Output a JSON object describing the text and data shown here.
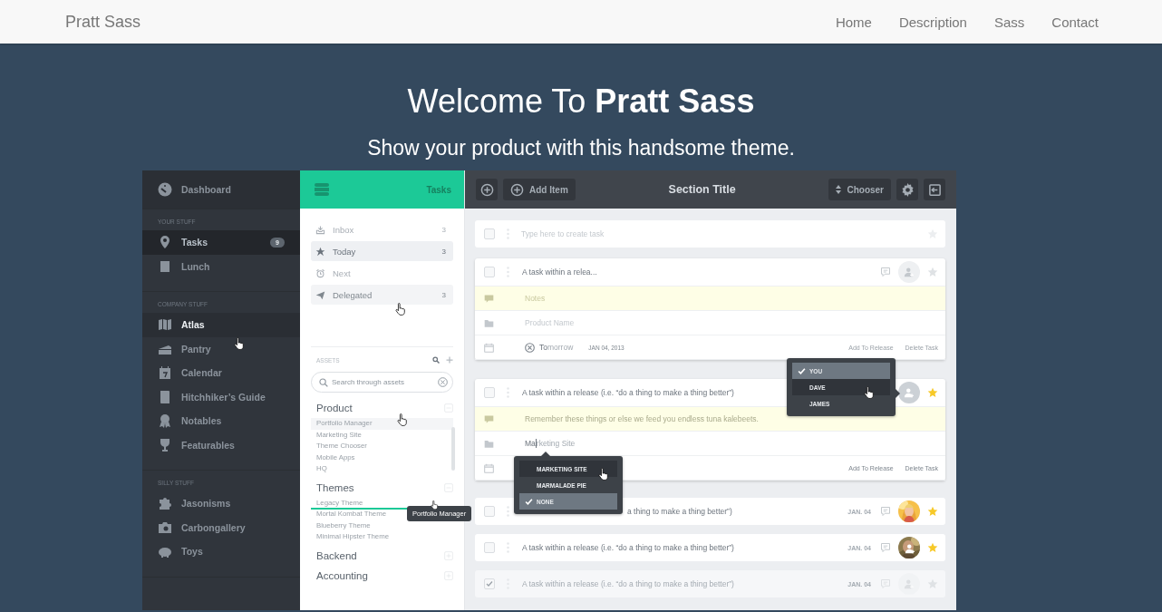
{
  "navbar": {
    "brand": "Pratt Sass",
    "links": [
      {
        "label": "Home"
      },
      {
        "label": "Description"
      },
      {
        "label": "Sass"
      },
      {
        "label": "Contact"
      }
    ]
  },
  "hero": {
    "title": "Welcome To **Pratt Sass**",
    "subtitle": "Show your product with this handsome theme."
  },
  "sidebar": {
    "header": {
      "label": "Dashboard"
    },
    "sections": [
      {
        "title": "YOUR STUFF",
        "items": [
          {
            "label": "Tasks",
            "badge": "9",
            "selected": true,
            "hovered": false
          },
          {
            "label": "Lunch",
            "selected": false,
            "hovered": false
          }
        ]
      },
      {
        "title": "COMPANY STUFF",
        "items": [
          {
            "label": "Atlas",
            "selected": false,
            "hovered": true
          },
          {
            "label": "Pantry",
            "selected": false,
            "hovered": false
          },
          {
            "label": "Calendar",
            "selected": false,
            "hovered": false
          },
          {
            "label": "Hitchhiker’s Guide",
            "selected": false,
            "hovered": false
          },
          {
            "label": "Notables",
            "selected": false,
            "hovered": false
          },
          {
            "label": "Featurables",
            "selected": false,
            "hovered": false
          }
        ]
      },
      {
        "title": "SILLY STUFF",
        "items": [
          {
            "label": "Jasonisms",
            "selected": false,
            "hovered": false
          },
          {
            "label": "Carbongallery",
            "selected": false,
            "hovered": false
          },
          {
            "label": "Toys",
            "selected": false,
            "hovered": false
          }
        ]
      }
    ]
  },
  "tasks_panel": {
    "title": "Tasks",
    "filters": [
      {
        "label": "Inbox",
        "count": "3",
        "selected": false,
        "hovered": false
      },
      {
        "label": "Today",
        "count": "3",
        "selected": true,
        "hovered": false
      },
      {
        "label": "Next",
        "selected": false,
        "hovered": false
      },
      {
        "label": "Delegated",
        "count": "3",
        "selected": false,
        "hovered": true
      }
    ],
    "assets": {
      "title": "ASSETS",
      "search": {
        "placeholder": "Search through assets"
      },
      "groups": [
        {
          "label": "Product",
          "expanded": true,
          "items": [
            {
              "label": "Portfolio Manager",
              "hovered": true,
              "drop_below": false
            },
            {
              "label": "Marketing Site",
              "hovered": false,
              "drop_below": false
            },
            {
              "label": "Theme Chooser",
              "hovered": false,
              "drop_below": false
            },
            {
              "label": "Mobile Apps",
              "hovered": false,
              "drop_below": false
            },
            {
              "label": "HQ",
              "hovered": false,
              "drop_below": false
            }
          ]
        },
        {
          "label": "Themes",
          "expanded": true,
          "items": [
            {
              "label": "Legacy Theme",
              "hovered": false,
              "drop_below": true
            },
            {
              "label": "Mortal Kombat Theme",
              "hovered": false,
              "drop_below": false
            },
            {
              "label": "Blueberry Theme",
              "hovered": false,
              "drop_below": false
            },
            {
              "label": "Minimal Hipster Theme",
              "hovered": false,
              "drop_below": false
            }
          ]
        },
        {
          "label": "Backend",
          "expanded": false
        },
        {
          "label": "Accounting",
          "expanded": false
        }
      ]
    }
  },
  "tooltip": "Portfolio Manager",
  "toolbar": {
    "add_item": "Add Item",
    "title": "Section Title",
    "chooser": "Chooser"
  },
  "tasks": [
    {
      "kind": "new",
      "placeholder": "Type here to create task",
      "checked": false,
      "starred": false
    },
    {
      "kind": "expanded",
      "title": "A task within a relea...",
      "checked": false,
      "starred": false,
      "notes_placeholder": "Notes",
      "product_placeholder": "Product Name",
      "date_value": "To",
      "date_suggestion": "morrow",
      "date": "JAN 04, 2013",
      "actions": [
        "Add To Release",
        "Delete Task"
      ],
      "emphasized": false
    },
    {
      "kind": "expanded",
      "title": "A task within a release (i.e. “do a thing to make a thing better”)",
      "checked": false,
      "starred": true,
      "notes": "Remember these things or else we feed you endless tuna kalebeets.",
      "product_value": "Ma",
      "product_suggestion": "rketing Site",
      "actions": [
        "Add To Release",
        "Delete Task"
      ],
      "emphasized": true,
      "assignee_menu": [
        {
          "label": "YOU",
          "selected": true,
          "hovered": false
        },
        {
          "label": "DAVE",
          "selected": false,
          "hovered": true
        },
        {
          "label": "JAMES",
          "selected": false,
          "hovered": false
        }
      ],
      "product_menu": [
        {
          "label": "MARKETING SITE",
          "selected": false,
          "hovered": true
        },
        {
          "label": "MARMALADE PIE",
          "selected": false,
          "hovered": false
        },
        {
          "label": "NONE",
          "selected": true,
          "hovered": false
        }
      ]
    },
    {
      "kind": "row",
      "title": "a thing to make a thing better”)",
      "covered": true,
      "checked": false,
      "starred": true,
      "date": "JAN. 04",
      "has_photo": true,
      "add_overlay": false
    },
    {
      "kind": "row",
      "title": "A task within a release (i.e. “do a thing to make a thing better”)",
      "covered": false,
      "checked": false,
      "starred": true,
      "date": "JAN. 04",
      "has_photo": true,
      "add_overlay": true
    },
    {
      "kind": "row",
      "title": "A task within a release (i.e. “do a thing to make a thing better”)",
      "covered": false,
      "checked": true,
      "starred": false,
      "date": "JAN. 04",
      "has_photo": false,
      "add_overlay": true
    }
  ]
}
